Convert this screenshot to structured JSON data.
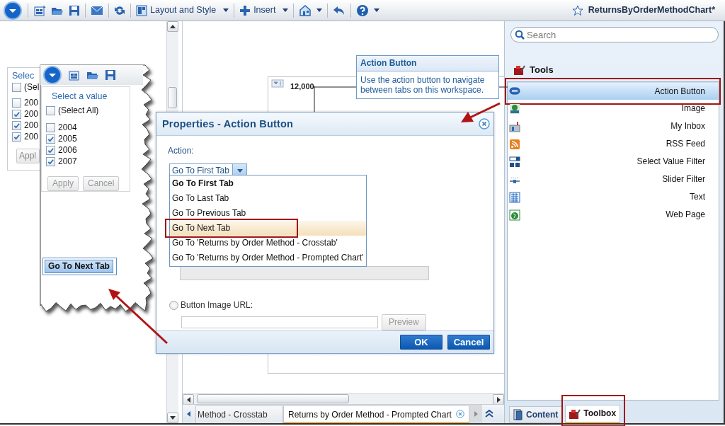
{
  "toolbar": {
    "menus": [
      {
        "label": "Layout and Style",
        "menu": true
      },
      {
        "label": "Insert",
        "menu": true
      }
    ],
    "document_title": "ReturnsByOrderMethodChart*"
  },
  "behind_filter": {
    "title": "Selec",
    "select_all": {
      "label": "(Sel",
      "checked": false
    },
    "items": [
      {
        "label": "200",
        "checked": false
      },
      {
        "label": "200",
        "checked": true
      },
      {
        "label": "200",
        "checked": true
      },
      {
        "label": "200",
        "checked": true
      }
    ],
    "apply": "Appl"
  },
  "inset": {
    "filter": {
      "title": "Select a value",
      "select_all": {
        "label": "(Select All)",
        "checked": false
      },
      "items": [
        {
          "label": "2004",
          "checked": false
        },
        {
          "label": "2005",
          "checked": true
        },
        {
          "label": "2006",
          "checked": true
        },
        {
          "label": "2007",
          "checked": true
        }
      ],
      "buttons": [
        {
          "label": "Apply",
          "disabled": true
        },
        {
          "label": "Cancel",
          "disabled": true
        }
      ]
    },
    "action_button": {
      "label": "Go To Next Tab"
    }
  },
  "chart": {
    "tick_label": "12,000"
  },
  "tooltip": {
    "title": "Action Button",
    "text": "Use the action button to navigate between tabs on this workspace."
  },
  "dialog": {
    "title": "Properties - Action Button",
    "action_label": "Action:",
    "action_value": "Go To First Tab",
    "options": [
      {
        "label": "Go To First Tab",
        "selected": true,
        "hovered": false,
        "callout": false
      },
      {
        "label": "Go To Last Tab",
        "selected": false,
        "hovered": false,
        "callout": false
      },
      {
        "label": "Go To Previous Tab",
        "selected": false,
        "hovered": false,
        "callout": false
      },
      {
        "label": "Go To Next Tab",
        "selected": false,
        "hovered": true,
        "callout": true
      },
      {
        "label": "Go To 'Returns by Order Method - Crosstab'",
        "selected": false,
        "hovered": false,
        "callout": false
      },
      {
        "label": "Go To 'Returns by Order Method - Prompted Chart'",
        "selected": false,
        "hovered": false,
        "callout": false
      }
    ],
    "link_field": {
      "disabled": true
    },
    "image_url": {
      "label": "Button Image URL:",
      "checked": false
    },
    "preview": "Preview",
    "buttons": [
      "OK",
      "Cancel"
    ]
  },
  "workspace_tabs": [
    {
      "label": "Method - Crosstab",
      "selected": false
    },
    {
      "label": "Returns by Order Method - Prompted Chart",
      "selected": true
    }
  ],
  "panel": {
    "search": {
      "placeholder": "Search"
    },
    "section": "Tools",
    "tools": [
      {
        "label": "Action Button",
        "kind": "button",
        "selected": true,
        "callout": true
      },
      {
        "label": "Image",
        "kind": "image",
        "selected": false,
        "callout": false
      },
      {
        "label": "My Inbox",
        "kind": "inbox",
        "selected": false,
        "callout": false
      },
      {
        "label": "RSS Feed",
        "kind": "rss",
        "selected": false,
        "callout": false
      },
      {
        "label": "Select Value Filter",
        "kind": "select",
        "selected": false,
        "callout": false
      },
      {
        "label": "Slider Filter",
        "kind": "slider",
        "selected": false,
        "callout": false
      },
      {
        "label": "Text",
        "kind": "text",
        "selected": false,
        "callout": false
      },
      {
        "label": "Web Page",
        "kind": "web",
        "selected": false,
        "callout": false
      }
    ],
    "tabs": [
      {
        "label": "Content",
        "kind": "content",
        "selected": false,
        "callout": false
      },
      {
        "label": "Toolbox",
        "kind": "toolbox",
        "selected": true,
        "callout": true
      }
    ]
  }
}
